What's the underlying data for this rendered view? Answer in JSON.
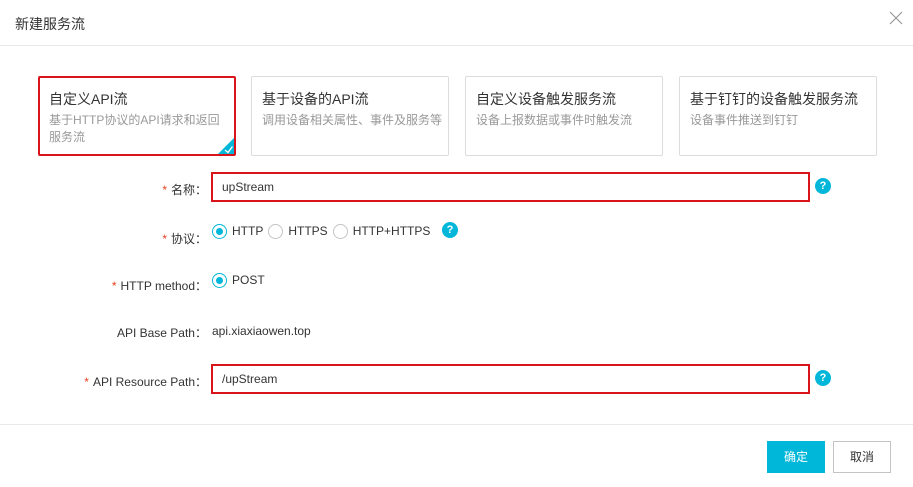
{
  "dialog": {
    "title": "新建服务流"
  },
  "cards": [
    {
      "title": "自定义API流",
      "desc": "基于HTTP协议的API请求和返回服务流",
      "selected": true
    },
    {
      "title": "基于设备的API流",
      "desc": "调用设备相关属性、事件及服务等",
      "selected": false
    },
    {
      "title": "自定义设备触发服务流",
      "desc": "设备上报数据或事件时触发流",
      "selected": false
    },
    {
      "title": "基于钉钉的设备触发服务流",
      "desc": "设备事件推送到钉钉",
      "selected": false
    }
  ],
  "form": {
    "required_mark": "*",
    "help_glyph": "?",
    "name": {
      "label": "名称：",
      "value": "upStream"
    },
    "protocol": {
      "label": "协议：",
      "options": [
        "HTTP",
        "HTTPS",
        "HTTP+HTTPS"
      ],
      "selected": "HTTP"
    },
    "method": {
      "label": "HTTP method：",
      "options": [
        "POST"
      ],
      "selected": "POST"
    },
    "base_path": {
      "label": "API Base Path：",
      "value": "api.xiaxiaowen.top"
    },
    "resource_path": {
      "label": "API Resource Path：",
      "value": "/upStream"
    }
  },
  "footer": {
    "confirm_label": "确定",
    "cancel_label": "取消"
  },
  "colors": {
    "accent": "#00b7d9",
    "highlight_border": "#d9141a",
    "required": "#e5401f"
  }
}
